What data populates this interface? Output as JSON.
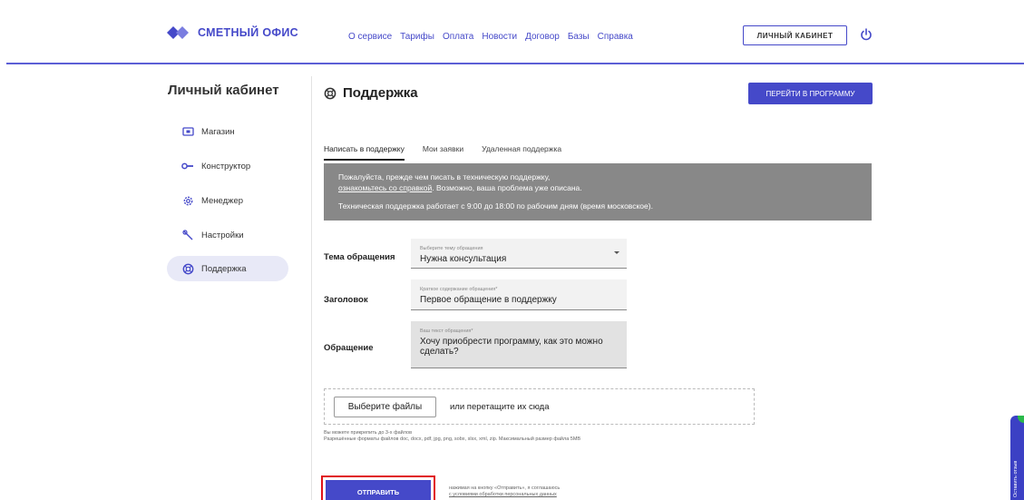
{
  "header": {
    "logo_text": "СМЕТНЫЙ ОФИС",
    "nav": [
      "О сервисе",
      "Тарифы",
      "Оплата",
      "Новости",
      "Договор",
      "Базы",
      "Справка"
    ],
    "cabinet_label": "ЛИЧНЫЙ КАБИНЕТ",
    "accent": "#4549c9"
  },
  "sidebar": {
    "title": "Личный кабинет",
    "items": [
      {
        "label": "Магазин",
        "icon": "store-icon"
      },
      {
        "label": "Конструктор",
        "icon": "key-icon"
      },
      {
        "label": "Менеджер",
        "icon": "gear-icon"
      },
      {
        "label": "Настройки",
        "icon": "wrench-icon"
      },
      {
        "label": "Поддержка",
        "icon": "lifebuoy-icon",
        "active": true
      }
    ]
  },
  "main": {
    "title": "Поддержка",
    "program_button": "ПЕРЕЙТИ В ПРОГРАММУ",
    "tabs": [
      "Написать в поддержку",
      "Мои заявки",
      "Удаленная поддержка"
    ],
    "notice": {
      "line1": "Пожалуйста, прежде чем писать в техническую поддержку,",
      "link": "ознакомьтесь со справкой",
      "line2_rest": ". Возможно, ваша проблема уже описана.",
      "line3": "Техническая поддержка работает с 9:00 до 18:00 по рабочим дням (время московское)."
    },
    "form": {
      "topic_label": "Тема обращения",
      "topic_placeholder": "Выберите тему обращения",
      "topic_value": "Нужна консультация",
      "subject_label": "Заголовок",
      "subject_placeholder": "Краткое содержание обращения*",
      "subject_value": "Первое обращение в поддержку",
      "message_label": "Обращение",
      "message_placeholder": "Ваш текст обращения*",
      "message_value": "Хочу приобрести программу, как это можно сделать?",
      "choose_files": "Выберите файлы",
      "drop_text": "или перетащите их сюда",
      "hint1": "Вы можете прикрепить до 3-х файлов",
      "hint2": "Разрешённые форматы файлов doc, docx, pdf, jpg, png, sobx, slsx, xml, zip. Максимальный размер файла 5MB",
      "send": "ОТПРАВИТЬ",
      "agree1": "нажимая на кнопку «Отправить», я соглашаюсь",
      "agree2": "с условиями обработки персональных данных"
    }
  },
  "feedback_widget": "Оставить отзыв"
}
